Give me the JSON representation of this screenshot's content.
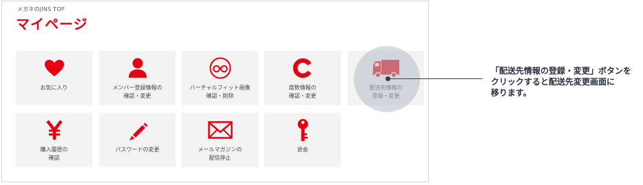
{
  "header": {
    "breadcrumb": "メガネのJINS TOP",
    "title": "マイページ"
  },
  "menu": [
    {
      "lines": [
        "お気に入り"
      ],
      "icon": "heart-icon"
    },
    {
      "lines": [
        "メンバー登録情報の",
        "確認・変更"
      ],
      "icon": "person-icon"
    },
    {
      "lines": [
        "バーチャルフィット画像",
        "確認・削除"
      ],
      "icon": "glasses-icon"
    },
    {
      "lines": [
        "度数情報の",
        "確認・変更"
      ],
      "icon": "letter-c-icon"
    },
    {
      "lines": [
        "配送先情報の",
        "登録・変更"
      ],
      "icon": "delivery-truck-icon"
    },
    {
      "lines": [
        "購入履歴の",
        "確認"
      ],
      "icon": "yen-icon"
    },
    {
      "lines": [
        "パスワードの変更"
      ],
      "icon": "pencil-icon"
    },
    {
      "lines": [
        "メールマガジンの",
        "配信停止"
      ],
      "icon": "envelope-icon"
    },
    {
      "lines": [
        "退会"
      ],
      "icon": "key-icon"
    }
  ],
  "callout": {
    "lines": [
      "「配送先情報の登録・変更」ボタンを",
      "クリックすると配送先変更画面に",
      "移ります。"
    ]
  },
  "colors": {
    "brand": "#e50012",
    "tile_bg": "#f3f3f3",
    "highlight": "#b5bec8",
    "callout_text": "#2a3140"
  }
}
